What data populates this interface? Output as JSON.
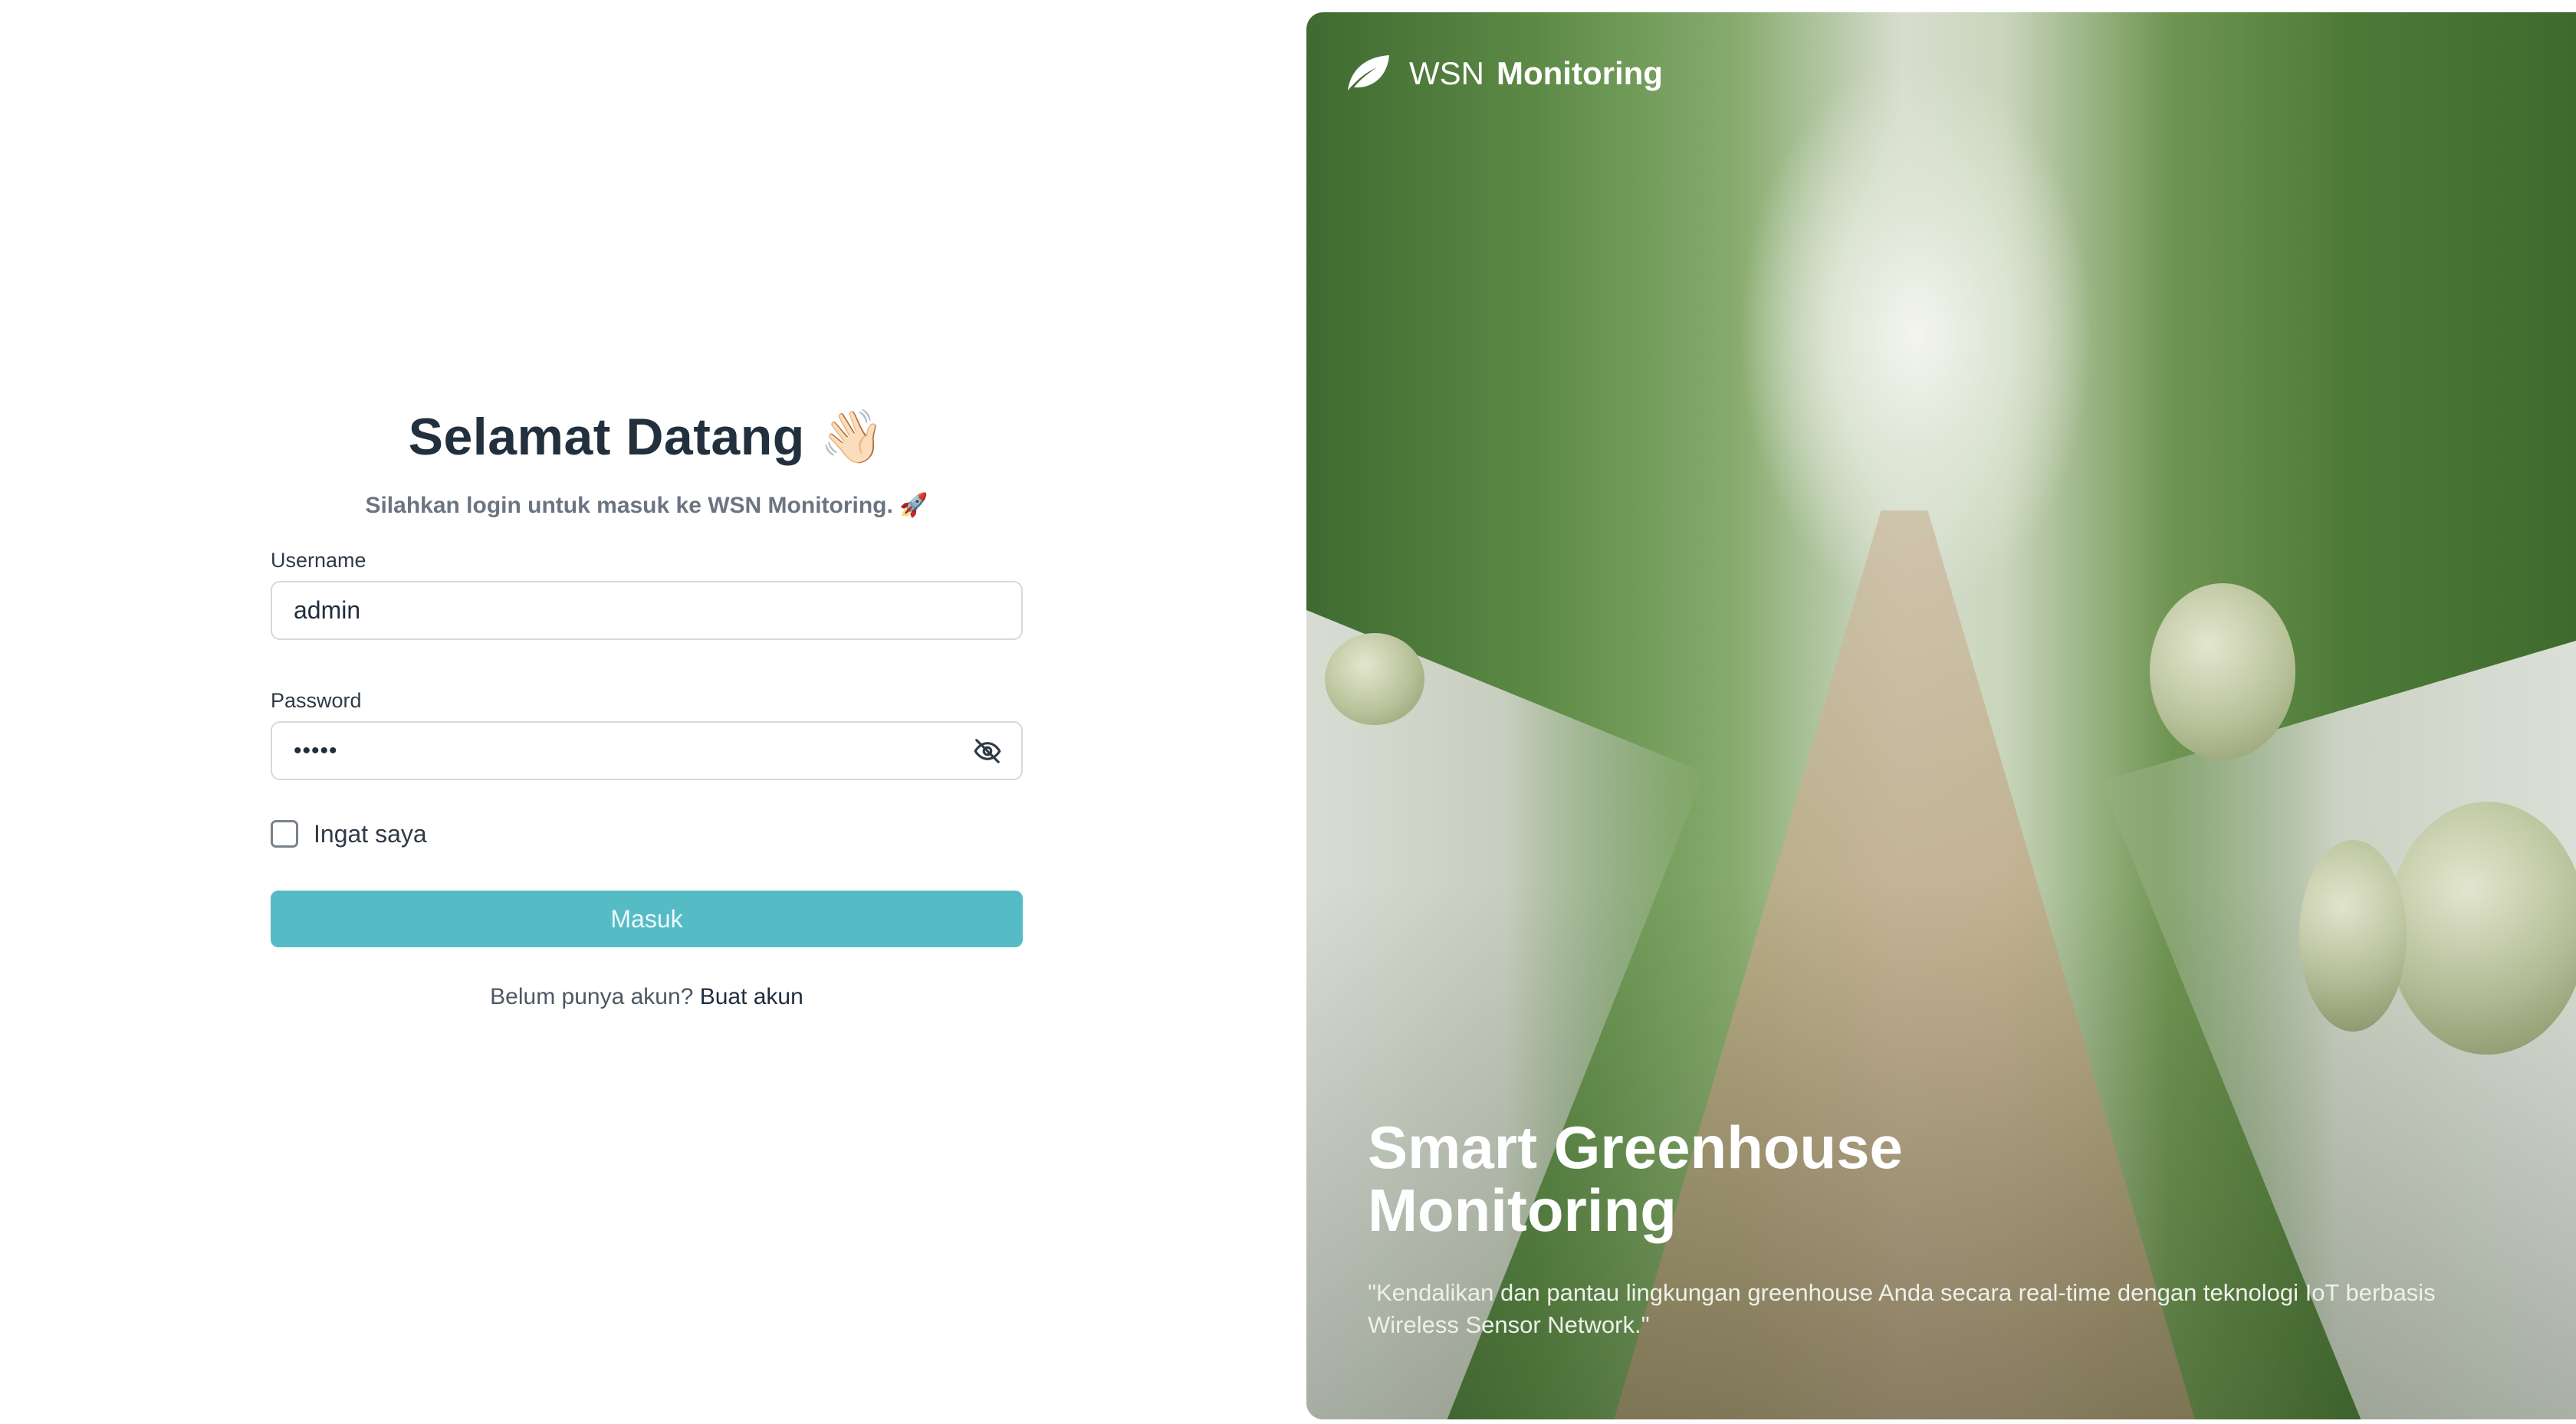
{
  "login": {
    "title": "Selamat Datang 👋🏻",
    "subtitle": "Silahkan login untuk masuk ke WSN Monitoring. 🚀",
    "username": {
      "label": "Username",
      "value": "admin"
    },
    "password": {
      "label": "Password",
      "value": "•••••",
      "toggle_icon": "eye-slash-icon"
    },
    "remember": {
      "label": "Ingat saya",
      "checked": false
    },
    "submit_label": "Masuk",
    "signup": {
      "prompt": "Belum punya akun?",
      "link": "Buat akun"
    },
    "colors": {
      "button": "#55bcc6",
      "text": "#22303e"
    }
  },
  "hero": {
    "brand": {
      "icon": "leaf-icon",
      "wsn": "WSN",
      "name": "Monitoring"
    },
    "title_line1": "Smart Greenhouse",
    "title_line2": "Monitoring",
    "quote": "\"Kendalikan dan pantau lingkungan greenhouse Anda secara real-time dengan teknologi IoT berbasis Wireless Sensor Network.\""
  }
}
